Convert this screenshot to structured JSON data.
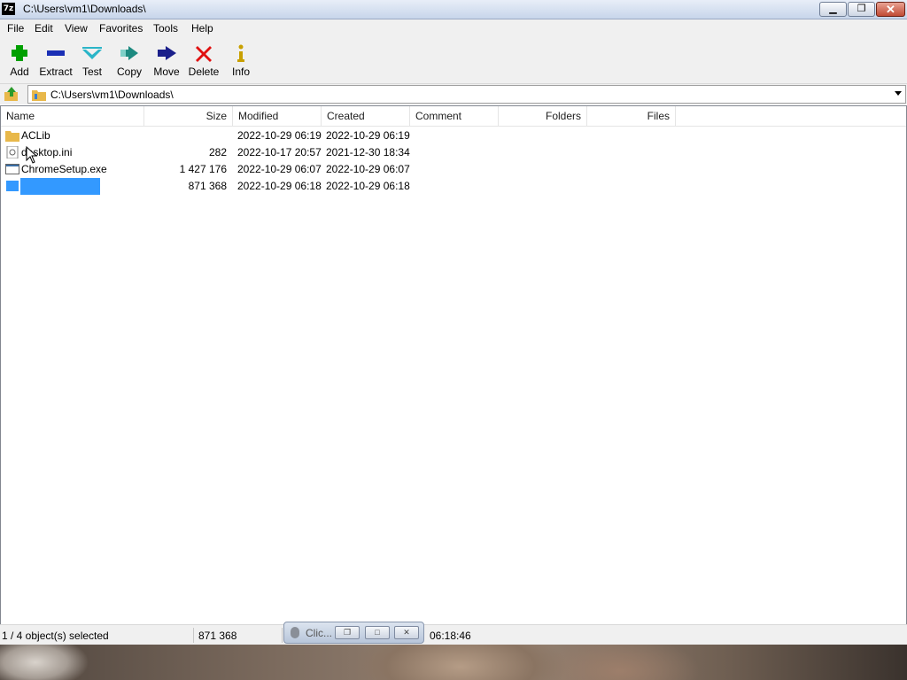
{
  "window": {
    "title": "C:\\Users\\vm1\\Downloads\\",
    "app_icon_text": "7z",
    "controls": {
      "minimize": "minimize",
      "maximize": "maximize",
      "close": "close"
    }
  },
  "menu": [
    "File",
    "Edit",
    "View",
    "Favorites",
    "Tools",
    "Help"
  ],
  "toolbar": [
    {
      "label": "Add",
      "icon": "plus-icon",
      "color": "#00a000"
    },
    {
      "label": "Extract",
      "icon": "minus-icon",
      "color": "#1a2fb5"
    },
    {
      "label": "Test",
      "icon": "checkmark-icon",
      "color": "#2ab5c8"
    },
    {
      "label": "Copy",
      "icon": "copy-arrow-icon",
      "color": "#1d8a80"
    },
    {
      "label": "Move",
      "icon": "move-arrow-icon",
      "color": "#1a1f8a"
    },
    {
      "label": "Delete",
      "icon": "x-icon",
      "color": "#e01010"
    },
    {
      "label": "Info",
      "icon": "info-icon",
      "color": "#c8a000"
    }
  ],
  "address": {
    "path": "C:\\Users\\vm1\\Downloads\\"
  },
  "columns": [
    "Name",
    "Size",
    "Modified",
    "Created",
    "Comment",
    "Folders",
    "Files"
  ],
  "files": [
    {
      "name": "ACLib",
      "size": "",
      "modified": "2022-10-29 06:19",
      "created": "2022-10-29 06:19",
      "icon": "folder-icon"
    },
    {
      "name": "desktop.ini",
      "size": "282",
      "modified": "2022-10-17 20:57",
      "created": "2021-12-30 18:34",
      "icon": "ini-file-icon"
    },
    {
      "name": "ChromeSetup.exe",
      "size": "1 427 176",
      "modified": "2022-10-29 06:07",
      "created": "2022-10-29 06:07",
      "icon": "exe-file-icon"
    },
    {
      "name": "",
      "size": "871 368",
      "modified": "2022-10-29 06:18",
      "created": "2022-10-29 06:18",
      "icon": "exe-file-icon",
      "selected": true
    }
  ],
  "status": {
    "selection": "1 / 4 object(s) selected",
    "size": "871 368",
    "time": "06:18:46"
  },
  "mini_window": {
    "title": "Clic..."
  },
  "colors": {
    "selection": "#3399ff",
    "folder": "#e8b84a"
  }
}
